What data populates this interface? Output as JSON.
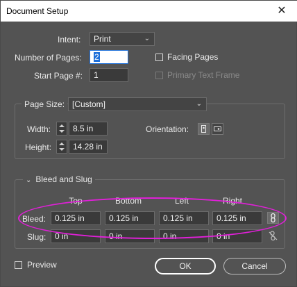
{
  "window": {
    "title": "Document Setup",
    "close_glyph": "✕"
  },
  "intent": {
    "label": "Intent:",
    "value": "Print"
  },
  "pages": {
    "label": "Number of Pages:",
    "value": "2"
  },
  "start_page": {
    "label": "Start Page #:",
    "value": "1"
  },
  "facing_pages": {
    "label": "Facing Pages",
    "checked": false
  },
  "primary_text_frame": {
    "label": "Primary Text Frame",
    "checked": false,
    "enabled": false
  },
  "page_size": {
    "label": "Page Size:",
    "value": "[Custom]",
    "width_label": "Width:",
    "width": "8.5 in",
    "height_label": "Height:",
    "height": "14.28 in",
    "orientation_label": "Orientation:",
    "orientation_selected": "portrait"
  },
  "bleed_slug": {
    "title": "Bleed and Slug",
    "expanded": true,
    "columns": [
      "Top",
      "Bottom",
      "Left",
      "Right"
    ],
    "bleed_label": "Bleed:",
    "bleed": [
      "0.125 in",
      "0.125 in",
      "0.125 in",
      "0.125 in"
    ],
    "slug_label": "Slug:",
    "slug": [
      "0 in",
      "0 in",
      "0 in",
      "0 in"
    ],
    "bleed_linked": true,
    "slug_linked": false
  },
  "preview": {
    "label": "Preview",
    "checked": false
  },
  "buttons": {
    "ok": "OK",
    "cancel": "Cancel"
  },
  "colors": {
    "dialog_bg": "#535353",
    "highlight_ellipse": "#e020d8",
    "selection": "#1e6fd9"
  }
}
